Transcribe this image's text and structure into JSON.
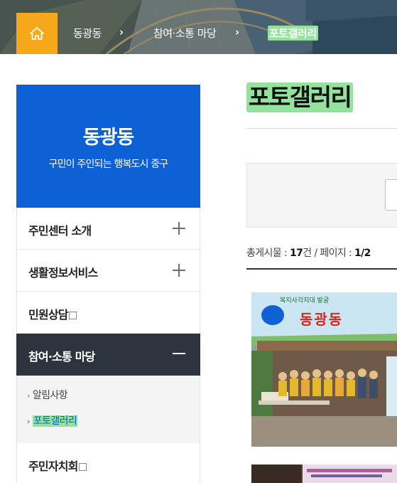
{
  "breadcrumb": {
    "home_icon": "home-icon",
    "items": [
      "동광동",
      "참여·소통 마당",
      "포토갤러리"
    ],
    "separator": "›"
  },
  "sidebar": {
    "site_name": "동광동",
    "slogan": "구민이 주인되는 행복도시 중구",
    "items": [
      {
        "label": "주민센터 소개",
        "icon": "plus-icon"
      },
      {
        "label": "생활정보서비스",
        "icon": "plus-icon"
      },
      {
        "label": "민원상담",
        "icon": "external-link-icon"
      },
      {
        "label": "참여·소통 마당",
        "icon": "minus-icon",
        "active": true
      },
      {
        "label": "주민자치회",
        "icon": "external-link-icon"
      }
    ],
    "sub_items": [
      {
        "label": "알림사항"
      },
      {
        "label": "포토갤러리",
        "current": true
      }
    ]
  },
  "main": {
    "title": "포토갤러리",
    "count": {
      "prefix": "총게시물 : ",
      "total": "17",
      "unit": "건",
      "page_prefix": " / 페이지 : ",
      "page": "1/2"
    },
    "photos": [
      {
        "banner_text": "동광동",
        "banner_sub": "복지사각지대 발굴"
      },
      {
        "banner_text": ""
      }
    ]
  },
  "colors": {
    "brand_blue": "#0d61d4",
    "home_orange": "#f6a81b",
    "active_nav": "#2e343e",
    "highlight": "#93e29d"
  }
}
